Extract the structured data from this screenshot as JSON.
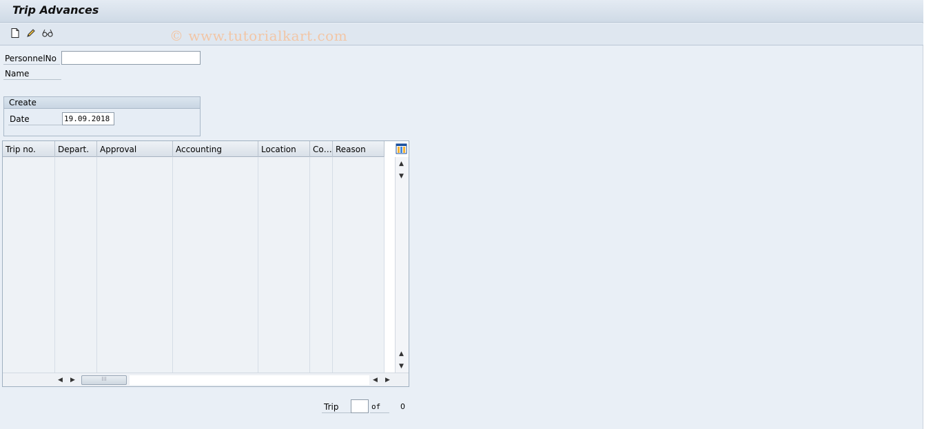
{
  "app": {
    "title": "Trip Advances",
    "watermark": "© www.tutorialkart.com"
  },
  "toolbar": {
    "buttons": [
      {
        "name": "new-document-icon",
        "tooltip": "Create"
      },
      {
        "name": "pencil-edit-icon",
        "tooltip": "Change"
      },
      {
        "name": "glasses-display-icon",
        "tooltip": "Display"
      }
    ]
  },
  "header_fields": {
    "personnel_label": "PersonnelNo",
    "personnel_value": "",
    "name_label": "Name"
  },
  "create_group": {
    "title": "Create",
    "date_label": "Date",
    "date_value": "19.09.2018"
  },
  "table": {
    "columns": [
      "Trip no.",
      "Depart.",
      "Approval",
      "Accounting",
      "Location",
      "Co…",
      "Reason"
    ],
    "rows": [],
    "visible_empty_rows": 15
  },
  "pager": {
    "trip_label": "Trip",
    "trip_value": "",
    "of_label": "of",
    "total": "0"
  }
}
